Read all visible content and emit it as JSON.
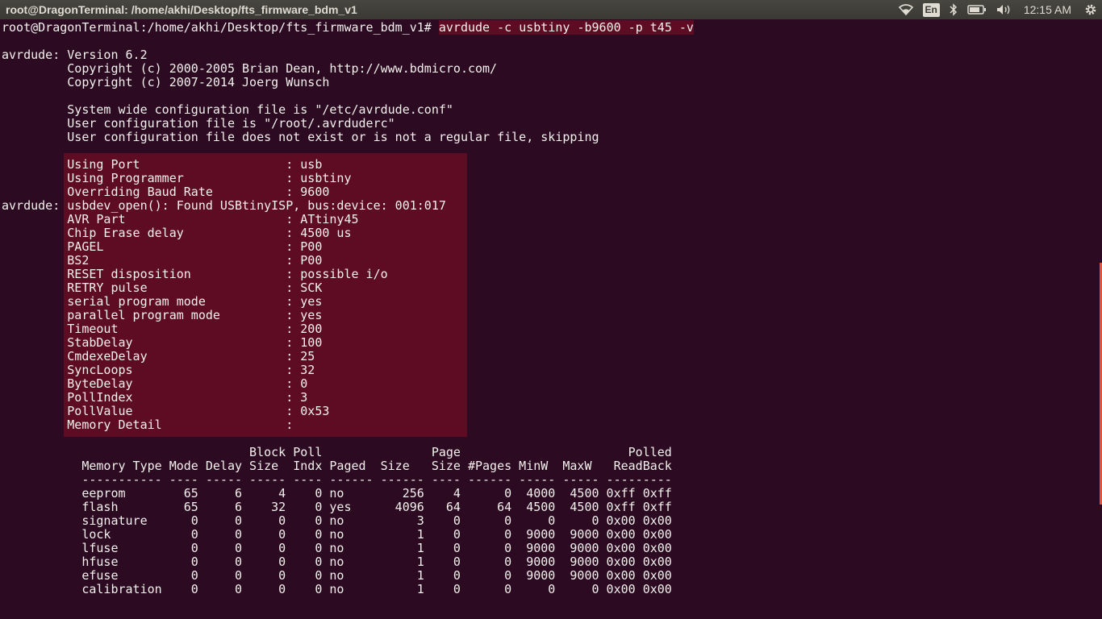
{
  "window": {
    "title": "root@DragonTerminal: /home/akhi/Desktop/fts_firmware_bdm_v1"
  },
  "tray": {
    "wifi_icon": "wifi-icon",
    "language": "En",
    "bluetooth_icon": "bluetooth-icon",
    "battery_icon": "battery-icon",
    "volume_icon": "volume-icon",
    "time": "12:15 AM",
    "settings_icon": "gear-icon"
  },
  "terminal": {
    "prompt": "root@DragonTerminal:/home/akhi/Desktop/fts_firmware_bdm_v1# ",
    "command": "avrdude -c usbtiny -b9600 -p t45 -v",
    "lines": [
      "avrdude: Version 6.2",
      "         Copyright (c) 2000-2005 Brian Dean, http://www.bdmicro.com/",
      "         Copyright (c) 2007-2014 Joerg Wunsch",
      "",
      "         System wide configuration file is \"/etc/avrdude.conf\"",
      "         User configuration file is \"/root/.avrduderc\"",
      "         User configuration file does not exist or is not a regular file, skipping",
      "",
      "         Using Port                    : usb",
      "         Using Programmer              : usbtiny",
      "         Overriding Baud Rate          : 9600",
      "avrdude: usbdev_open(): Found USBtinyISP, bus:device: 001:017",
      "         AVR Part                      : ATtiny45",
      "         Chip Erase delay              : 4500 us",
      "         PAGEL                         : P00",
      "         BS2                           : P00",
      "         RESET disposition             : possible i/o",
      "         RETRY pulse                   : SCK",
      "         serial program mode           : yes",
      "         parallel program mode         : yes",
      "         Timeout                       : 200",
      "         StabDelay                     : 100",
      "         CmdexeDelay                   : 25",
      "         SyncLoops                     : 32",
      "         ByteDelay                     : 0",
      "         PollIndex                     : 3",
      "         PollValue                     : 0x53",
      "         Memory Detail                 :",
      "",
      "                                  Block Poll               Page                       Polled",
      "           Memory Type Mode Delay Size  Indx Paged  Size   Size #Pages MinW  MaxW   ReadBack",
      "           ----------- ---- ----- ----- ---- ------ ------ ---- ------ ----- ----- ---------",
      "           eeprom        65     6     4    0 no        256    4      0  4000  4500 0xff 0xff",
      "           flash         65     6    32    0 yes      4096   64     64  4500  4500 0xff 0xff",
      "           signature      0     0     0    0 no          3    0      0     0     0 0x00 0x00",
      "           lock           0     0     0    0 no          1    0      0  9000  9000 0x00 0x00",
      "           lfuse          0     0     0    0 no          1    0      0  9000  9000 0x00 0x00",
      "           hfuse          0     0     0    0 no          1    0      0  9000  9000 0x00 0x00",
      "           efuse          0     0     0    0 no          1    0      0  9000  9000 0x00 0x00",
      "           calibration    0     0     0    0 no          1    0      0     0     0 0x00 0x00"
    ]
  }
}
